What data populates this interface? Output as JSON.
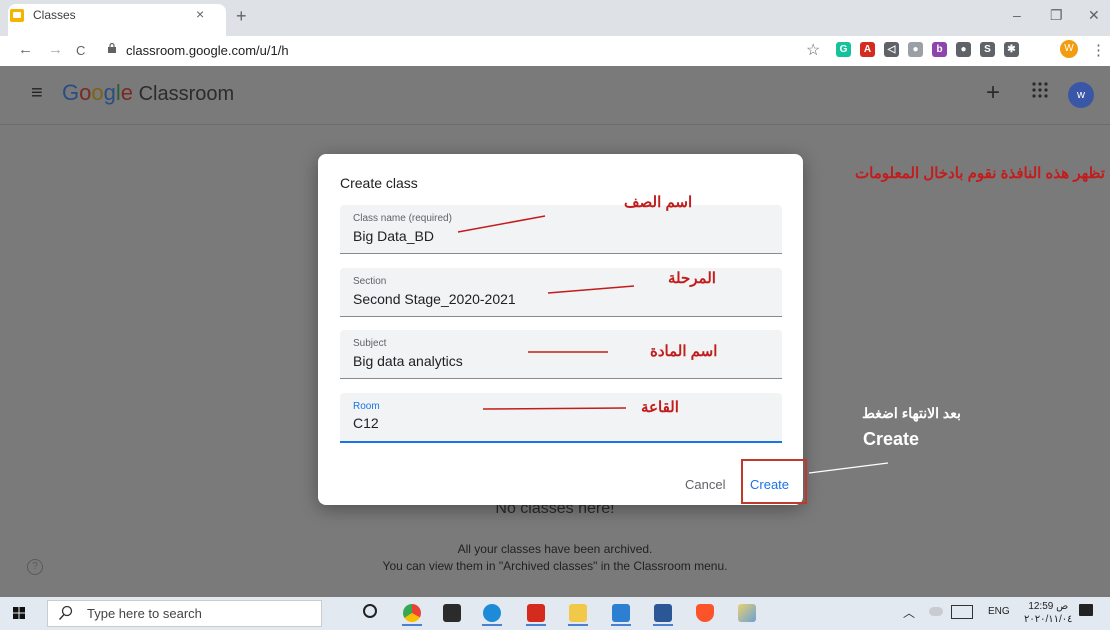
{
  "browser": {
    "tab_title": "Classes",
    "tab_close": "×",
    "new_tab": "+",
    "window_min": "–",
    "window_restore": "❐",
    "window_close": "✕",
    "back": "←",
    "forward": "→",
    "reload": "C",
    "url": "classroom.google.com/u/1/h",
    "star": "☆",
    "profile_initial": "W",
    "menu": "⋮"
  },
  "extensions": [
    {
      "icon": "grammarly-icon",
      "glyph": "G",
      "color": "#15c39a"
    },
    {
      "icon": "acrobat-icon",
      "glyph": "A",
      "color": "#d52b1e"
    },
    {
      "icon": "mute-icon",
      "glyph": "◁",
      "color": "#5f6368"
    },
    {
      "icon": "apple-icon",
      "glyph": "●",
      "color": "#9aa0a6"
    },
    {
      "icon": "b-extension-icon",
      "glyph": "b",
      "color": "#8e44ad"
    },
    {
      "icon": "circle-ext-icon",
      "glyph": "●",
      "color": "#5f6368"
    },
    {
      "icon": "s-ext-icon",
      "glyph": "S",
      "color": "#5f6368"
    },
    {
      "icon": "puzzle-icon",
      "glyph": "✱",
      "color": "#5f6368"
    }
  ],
  "app": {
    "menu_glyph": "≡",
    "logo_parts": [
      "G",
      "o",
      "o",
      "g",
      "l",
      "e"
    ],
    "logo_product": " Classroom",
    "add_glyph": "+",
    "apps_glyph": "⋮⋮⋮",
    "avatar": "w"
  },
  "background": {
    "empty_title": "No classes here!",
    "archived_line1": "All your classes have been archived.",
    "archived_line2": "You can view them in \"Archived classes\" in the Classroom menu.",
    "help": "?"
  },
  "dialog": {
    "title": "Create class",
    "fields": [
      {
        "label": "Class name (required)",
        "value": "Big Data_BD"
      },
      {
        "label": "Section",
        "value": "Second Stage_2020-2021"
      },
      {
        "label": "Subject",
        "value": "Big data analytics"
      },
      {
        "label": "Room",
        "value": "C12"
      }
    ],
    "cancel": "Cancel",
    "create": "Create"
  },
  "annotations": {
    "header": "تظهر هذه النافذة نقوم بادخال المعلومات",
    "class_name": "اسم الصف",
    "section": "المرحلة",
    "subject": "اسم المادة",
    "room": "القاعة",
    "finish_line1": "بعد الانتهاء اضغط",
    "finish_line2": "Create"
  },
  "taskbar": {
    "search_placeholder": "Type here to search",
    "lang": "ENG",
    "time": "12:59 ص",
    "date": "٢٠٢٠/١١/٠٤"
  }
}
